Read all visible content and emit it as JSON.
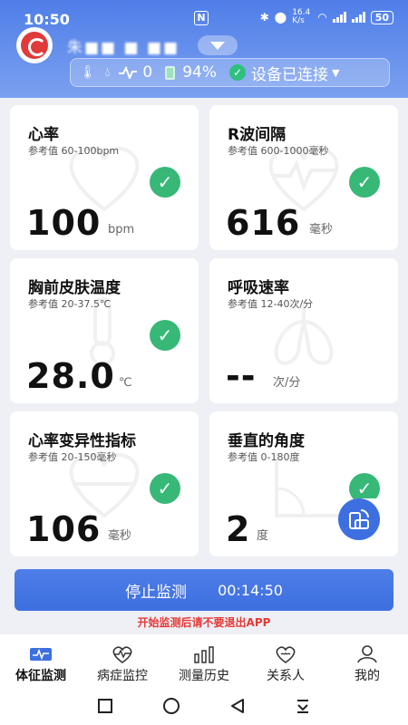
{
  "status": {
    "time": "10:50",
    "nfc": "N",
    "speed": "16.4 K/s",
    "battery": "50"
  },
  "user": {
    "name": "朱■■ ■ ■■"
  },
  "device": {
    "heart_count": "0",
    "battery_pct": "94%",
    "status": "设备已连接"
  },
  "cards": [
    {
      "title": "心率",
      "ref": "参考值  60-100bpm",
      "value": "100",
      "unit": "bpm"
    },
    {
      "title": "R波间隔",
      "ref": "参考值  600-1000毫秒",
      "value": "616",
      "unit": "毫秒"
    },
    {
      "title": "胸前皮肤温度",
      "ref": "参考值  20-37.5℃",
      "value": "28.0",
      "unit": "℃"
    },
    {
      "title": "呼吸速率",
      "ref": "参考值  12-40次/分",
      "value": "--",
      "unit": "次/分"
    },
    {
      "title": "心率变异性指标",
      "ref": "参考值  20-150毫秒",
      "value": "106",
      "unit": "毫秒"
    },
    {
      "title": "垂直的角度",
      "ref": "参考值  0-180度",
      "value": "2",
      "unit": "度"
    }
  ],
  "monitor": {
    "stop_label": "停止监测",
    "elapsed": "00:14:50",
    "warning": "开始监测后请不要退出APP"
  },
  "tabs": [
    {
      "label": "体征监测",
      "icon": "vital-signs-icon"
    },
    {
      "label": "病症监控",
      "icon": "heart-monitor-icon"
    },
    {
      "label": "测量历史",
      "icon": "bar-chart-icon"
    },
    {
      "label": "关系人",
      "icon": "contacts-heart-icon"
    },
    {
      "label": "我的",
      "icon": "person-icon"
    }
  ],
  "colors": {
    "accent": "#3d6fe0",
    "ok": "#37b877",
    "warning": "#e53935"
  }
}
